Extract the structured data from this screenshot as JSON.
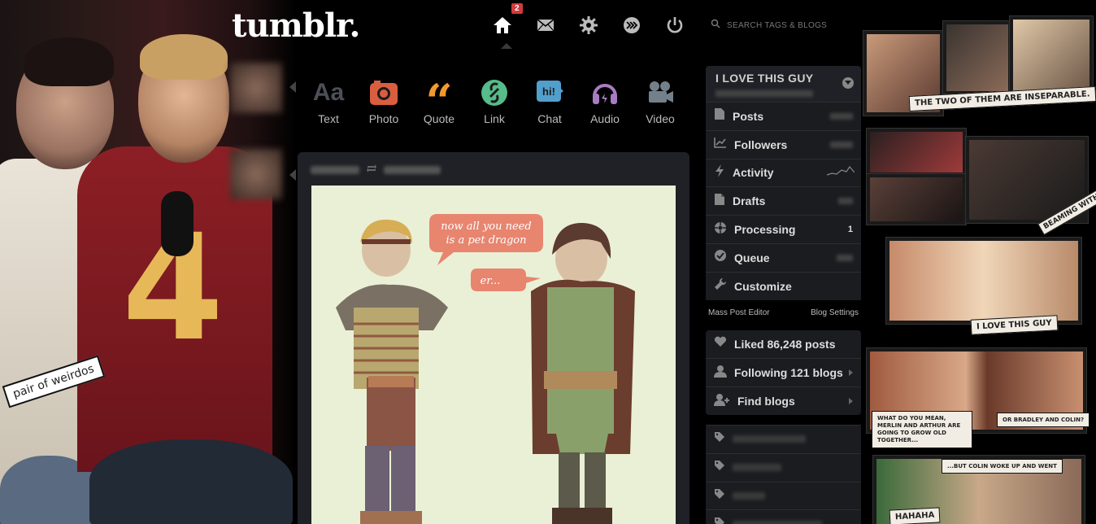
{
  "app": {
    "logo": "tumblr."
  },
  "topnav": {
    "items": [
      {
        "name": "home",
        "badge": "2"
      },
      {
        "name": "inbox"
      },
      {
        "name": "settings"
      },
      {
        "name": "xkit"
      },
      {
        "name": "logout"
      }
    ]
  },
  "search": {
    "placeholder": "SEARCH TAGS & BLOGS"
  },
  "post_types": [
    {
      "label": "Text",
      "icon": "text-icon",
      "color": "#4b4f57"
    },
    {
      "label": "Photo",
      "icon": "camera-icon",
      "color": "#d95e40"
    },
    {
      "label": "Quote",
      "icon": "quote-icon",
      "color": "#f2992e"
    },
    {
      "label": "Link",
      "icon": "link-icon",
      "color": "#56bc8a"
    },
    {
      "label": "Chat",
      "icon": "chat-icon",
      "color": "#529ecc"
    },
    {
      "label": "Audio",
      "icon": "headphones-icon",
      "color": "#a77dc2"
    },
    {
      "label": "Video",
      "icon": "video-camera-icon",
      "color": "#748089"
    }
  ],
  "left_photo": {
    "caption": "pair of weirdos"
  },
  "post": {
    "bubble1": "now all you need\nis a pet dragon",
    "bubble2": "er..."
  },
  "sidebar": {
    "blog_title": "I LOVE THIS GUY",
    "menu": [
      {
        "label": "Posts",
        "icon": "document-icon"
      },
      {
        "label": "Followers",
        "icon": "chart-icon"
      },
      {
        "label": "Activity",
        "icon": "lightning-icon"
      },
      {
        "label": "Drafts",
        "icon": "draft-icon"
      },
      {
        "label": "Processing",
        "icon": "processing-icon",
        "count": "1"
      },
      {
        "label": "Queue",
        "icon": "check-icon"
      },
      {
        "label": "Customize",
        "icon": "wrench-icon"
      }
    ],
    "mass_post_editor": "Mass Post Editor",
    "blog_settings": "Blog Settings",
    "group2": [
      {
        "label": "Liked 86,248 posts",
        "icon": "heart-icon"
      },
      {
        "label": "Following 121 blogs",
        "icon": "person-icon"
      },
      {
        "label": "Find blogs",
        "icon": "add-person-icon"
      }
    ]
  },
  "collage": {
    "strip1": "THE TWO OF THEM ARE INSEPARABLE.",
    "strip2": "BEAMING WITH PRIDE",
    "strip3": "I LOVE THIS GUY",
    "strip4": "WHAT DO YOU MEAN, MERLIN AND ARTHUR ARE GOING TO GROW OLD TOGETHER...",
    "strip5": "OR BRADLEY AND COLIN?",
    "strip6": "...BUT COLIN WOKE UP AND WENT",
    "strip7": "HAHAHA"
  }
}
